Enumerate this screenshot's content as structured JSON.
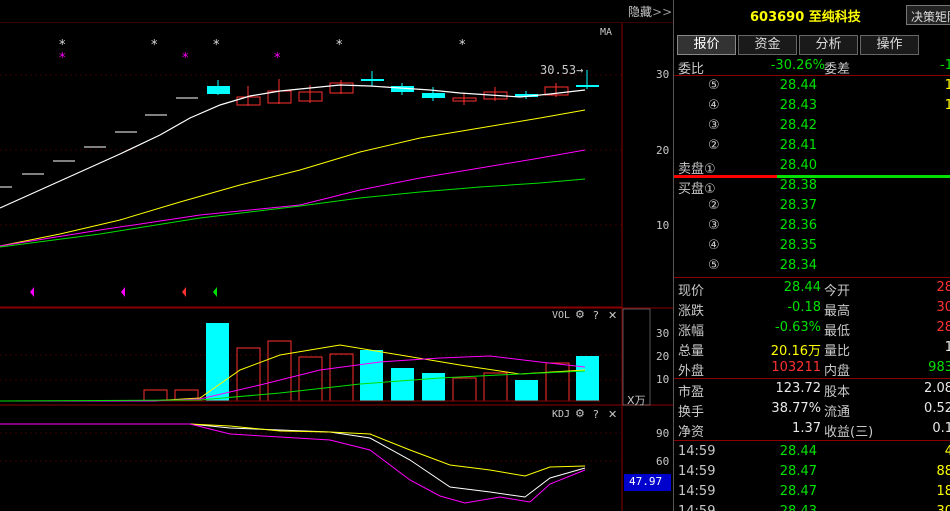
{
  "toolbar": {
    "hide_label": "隐藏",
    "hide_arrow": ">>"
  },
  "main_chart": {
    "ma_label": "MA",
    "price_callout": "30.53→",
    "y_ticks": [
      "30",
      "20",
      "10"
    ],
    "star_glyph": "*",
    "colors": {
      "up": "#ff3030",
      "down": "#00ffff",
      "ma5": "#ffffff",
      "ma10": "#ffff00",
      "ma20": "#ff00ff",
      "ma60": "#00e000"
    }
  },
  "vol_panel": {
    "title": "VOL",
    "y_ticks": [
      "30",
      "20",
      "10"
    ],
    "unit": "X万",
    "gear_icon": "⚙",
    "help_icon": "?",
    "close_icon": "✕"
  },
  "kdj_panel": {
    "title": "KDJ",
    "y_ticks": [
      "90",
      "60"
    ],
    "current_value": "47.97",
    "gear_icon": "⚙",
    "help_icon": "?",
    "close_icon": "✕"
  },
  "quote": {
    "code_name": "603690 至纯科技",
    "decision_button": "决策矩阵",
    "tabs": [
      "报价",
      "资金",
      "分析",
      "操作"
    ],
    "weibi": {
      "label": "委比",
      "value": "-30.26%",
      "label2": "委差",
      "value2": "-1"
    },
    "sell": [
      {
        "label": "⑤",
        "price": "28.44",
        "vol": "1"
      },
      {
        "label": "④",
        "price": "28.43",
        "vol": "1"
      },
      {
        "label": "③",
        "price": "28.42",
        "vol": ""
      },
      {
        "label": "②",
        "price": "28.41",
        "vol": ""
      },
      {
        "label": "卖盘①",
        "price": "28.40",
        "vol": ""
      }
    ],
    "buy": [
      {
        "label": "买盘①",
        "price": "28.38",
        "vol": ""
      },
      {
        "label": "②",
        "price": "28.37",
        "vol": ""
      },
      {
        "label": "③",
        "price": "28.36",
        "vol": ""
      },
      {
        "label": "④",
        "price": "28.35",
        "vol": ""
      },
      {
        "label": "⑤",
        "price": "28.34",
        "vol": ""
      }
    ],
    "stats": [
      {
        "l1": "现价",
        "v1": "28.44",
        "l2": "今开",
        "v2": "28"
      },
      {
        "l1": "涨跌",
        "v1": "-0.18",
        "l2": "最高",
        "v2": "30"
      },
      {
        "l1": "涨幅",
        "v1": "-0.63%",
        "l2": "最低",
        "v2": "28"
      },
      {
        "l1": "总量",
        "v1": "20.16万",
        "l2": "量比",
        "v2": "1"
      },
      {
        "l1": "外盘",
        "v1": "103211",
        "l2": "内盘",
        "v2": "983"
      }
    ],
    "fin": [
      {
        "l1": "市盈",
        "v1": "123.72",
        "l2": "股本",
        "v2": "2.08"
      },
      {
        "l1": "换手",
        "v1": "38.77%",
        "l2": "流通",
        "v2": "0.52"
      },
      {
        "l1": "净资",
        "v1": "1.37",
        "l2": "收益(三)",
        "v2": "0.1"
      }
    ],
    "ticks": [
      {
        "time": "14:59",
        "price": "28.44",
        "vol": "4"
      },
      {
        "time": "14:59",
        "price": "28.47",
        "vol": "88"
      },
      {
        "time": "14:59",
        "price": "28.47",
        "vol": "18"
      },
      {
        "time": "14:59",
        "price": "28.43",
        "vol": "30"
      }
    ]
  }
}
